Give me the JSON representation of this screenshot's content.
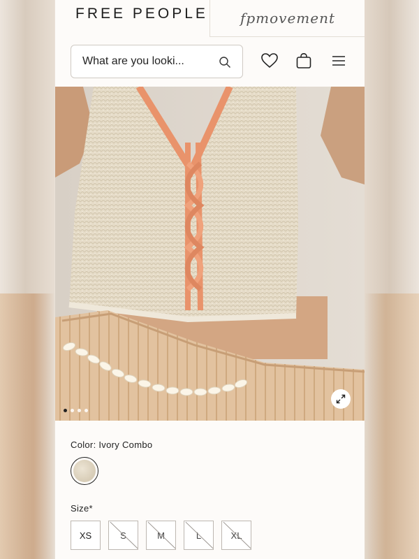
{
  "header": {
    "brand": "FREE PEOPLE",
    "sub_brand": "fpmovement",
    "search": {
      "placeholder": "What are you looki..."
    },
    "icons": [
      "heart-icon",
      "bag-icon",
      "menu-icon",
      "search-icon"
    ]
  },
  "product_image": {
    "carousel": {
      "count": 4,
      "active_index": 0
    },
    "expand_icon": "expand-icon"
  },
  "product": {
    "color_label": "Color: Ivory Combo",
    "size_label": "Size*",
    "sizes": [
      {
        "label": "XS",
        "available": true
      },
      {
        "label": "S",
        "available": false
      },
      {
        "label": "M",
        "available": false
      },
      {
        "label": "L",
        "available": false
      },
      {
        "label": "XL",
        "available": false
      }
    ]
  },
  "colors": {
    "text": "#1d1d1d",
    "page_bg": "#fdfbf9",
    "border": "#cfcac4",
    "sweater": "#e6dcc8",
    "trim": "#e9936b",
    "pants": "#e2c29f"
  }
}
